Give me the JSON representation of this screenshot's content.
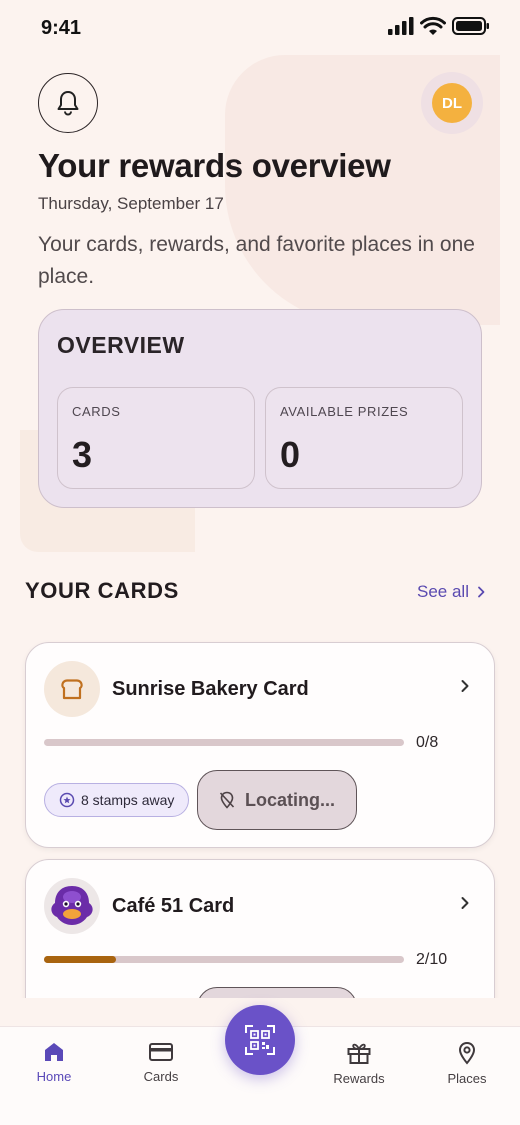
{
  "status_bar": {
    "time": "9:41"
  },
  "header": {
    "avatar_initials": "DL",
    "title": "Your rewards overview",
    "date": "Thursday, September 17",
    "subtitle": "Your cards, rewards, and favorite places in one place."
  },
  "overview": {
    "title": "OVERVIEW",
    "stats": [
      {
        "label": "CARDS",
        "value": "3"
      },
      {
        "label": "AVAILABLE PRIZES",
        "value": "0"
      }
    ]
  },
  "cards_section": {
    "title": "YOUR CARDS",
    "see_all": "See all",
    "cards": [
      {
        "name": "Sunrise Bakery Card",
        "progress_text": "0/8",
        "progress": 0,
        "stamps_away": "8 stamps away",
        "action": "Locating..."
      },
      {
        "name": "Café 51 Card",
        "progress_text": "2/10",
        "progress": 0.2
      }
    ]
  },
  "nav": {
    "items": [
      {
        "label": "Home",
        "icon": "home-icon",
        "active": true
      },
      {
        "label": "Cards",
        "icon": "card-icon"
      },
      {
        "label": "Rewards",
        "icon": "gift-icon"
      },
      {
        "label": "Places",
        "icon": "location-pin-icon"
      }
    ],
    "scan_icon": "qr-code-icon"
  },
  "colors": {
    "accent": "#6a52c8",
    "avatar": "#f4b13f",
    "progress": "#a9640f",
    "background": "#fcf3ef"
  }
}
